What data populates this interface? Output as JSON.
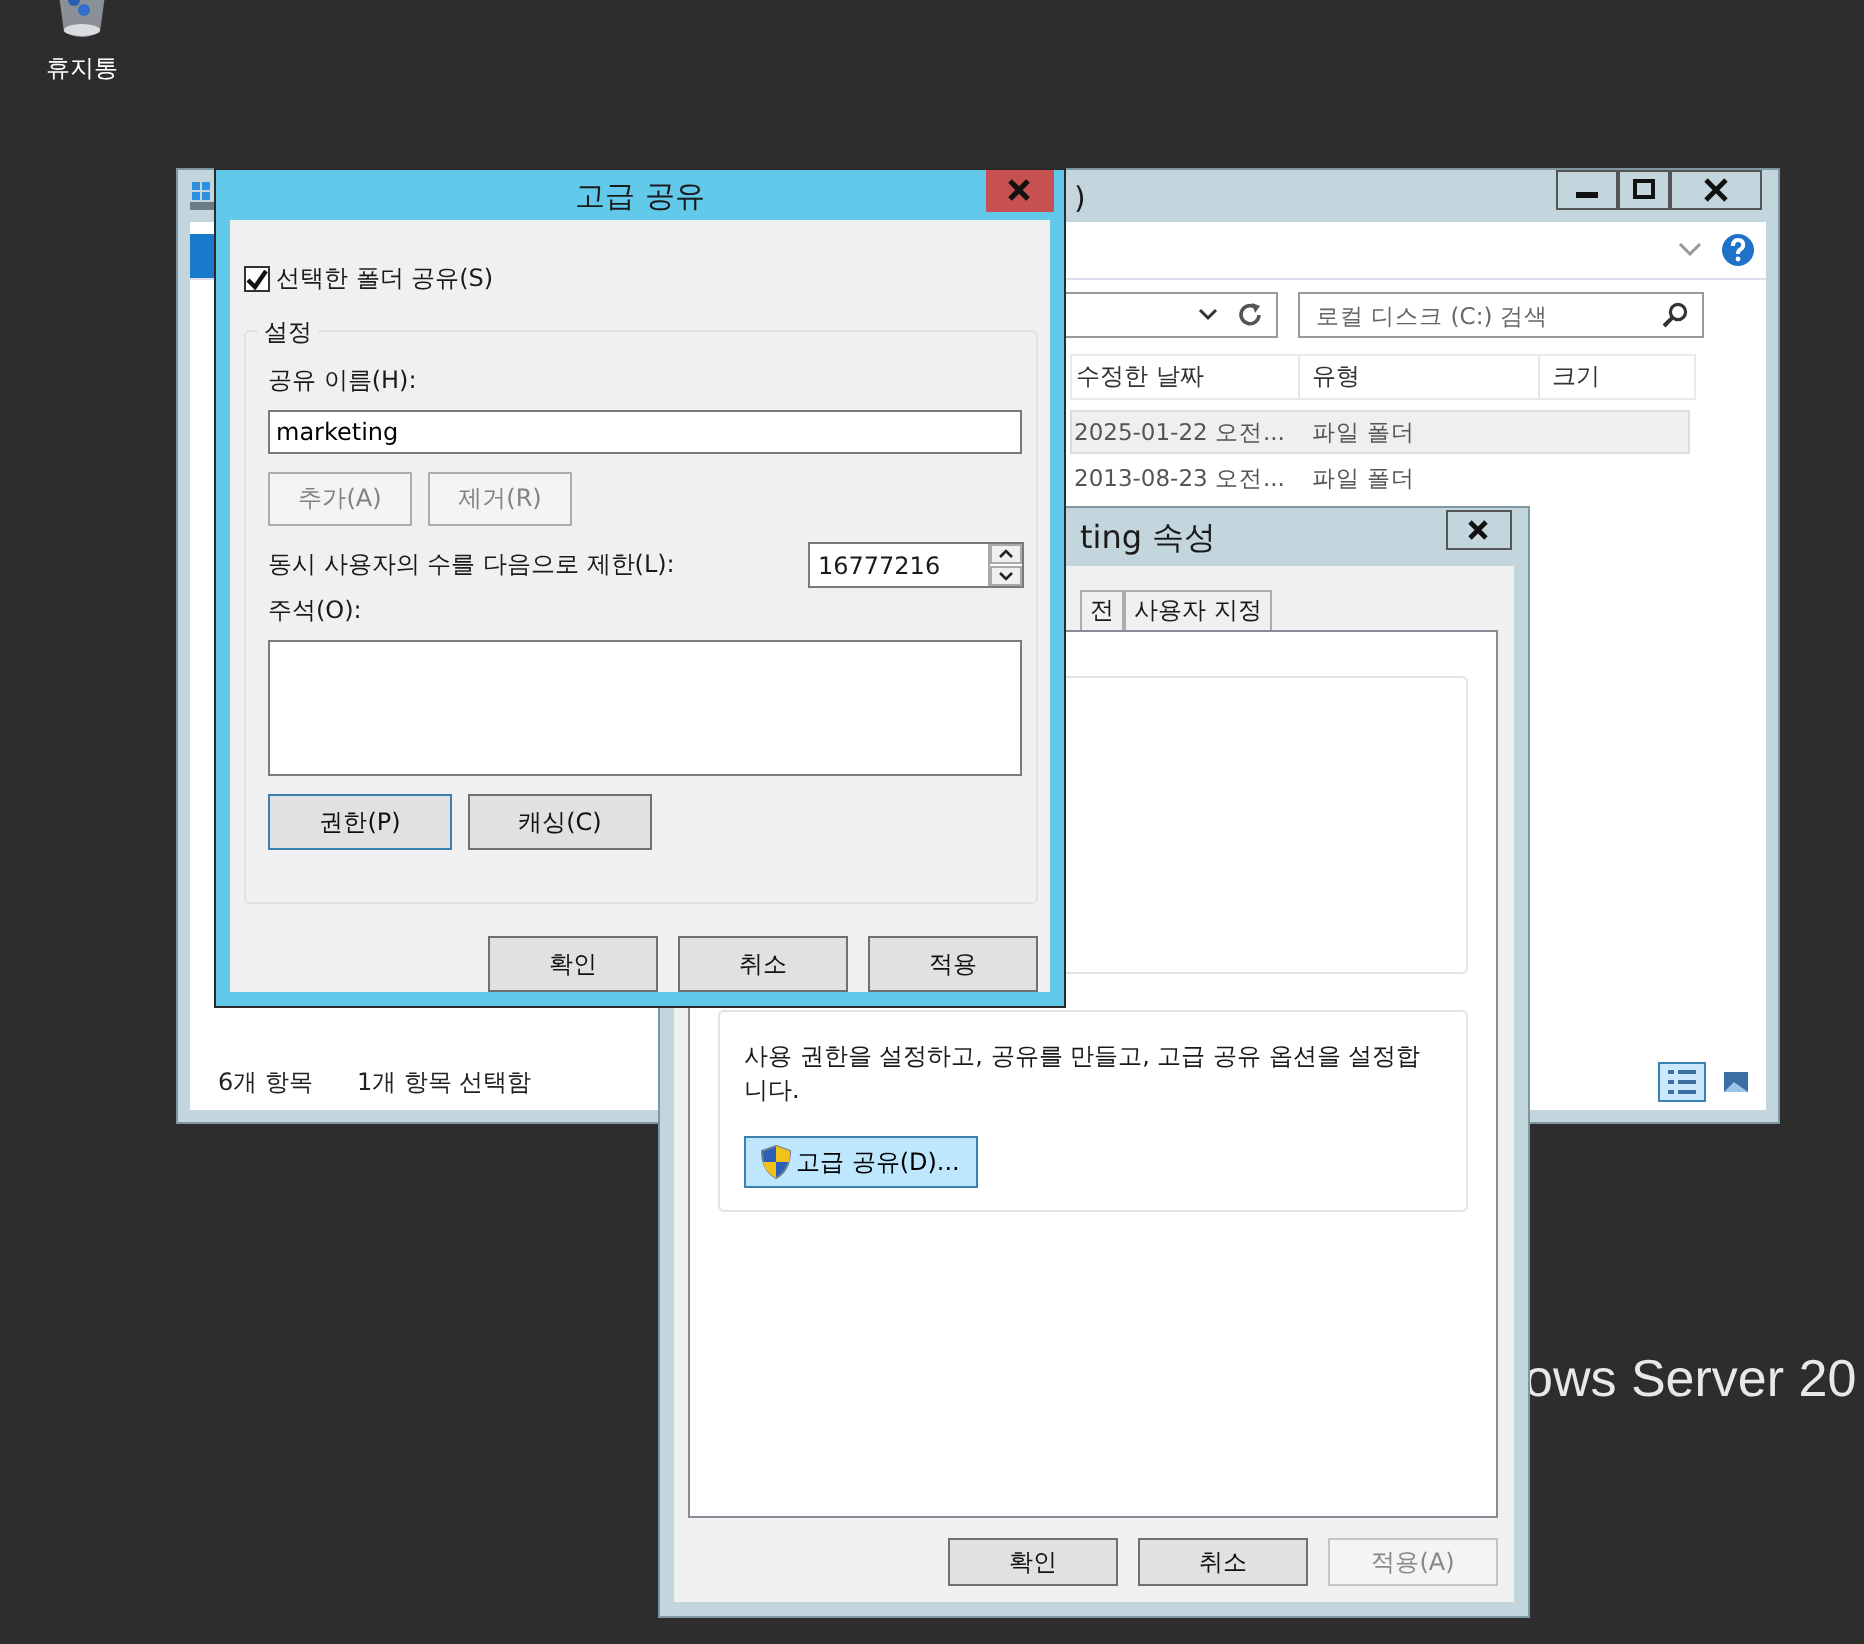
{
  "desktop": {
    "icons": [
      {
        "label": "휴지통"
      }
    ],
    "wallpaper_text": "ows Server 20"
  },
  "explorer": {
    "title": ")",
    "search": {
      "placeholder": "로컬 디스크 (C:) 검색"
    },
    "columns": [
      "수정한 날짜",
      "유형",
      "크기"
    ],
    "rows": [
      {
        "cells": [
          "2025-01-22 오전...",
          "파일 폴더"
        ],
        "selected": true
      },
      {
        "cells": [
          "2013-08-23 오전...",
          "파일 폴더"
        ],
        "selected": false
      }
    ],
    "status_bar": [
      "6개 항목",
      "1개 항목 선택함"
    ],
    "view_buttons": [
      {
        "kind": "details",
        "selected": true
      },
      {
        "kind": "thumbnails",
        "selected": false
      }
    ]
  },
  "properties": {
    "title": "ting 속성",
    "tabs": [
      {
        "label": "전",
        "selected": false
      },
      {
        "label": "사용자 지정",
        "selected": false
      }
    ],
    "sharing_description": "사용 권한을 설정하고, 공유를 만들고, 고급 공유 옵션을 설정합니다.",
    "advanced_button": "고급 공유(D)...",
    "buttons": [
      {
        "label": "확인",
        "disabled": false
      },
      {
        "label": "취소",
        "disabled": false
      },
      {
        "label": "적용(A)",
        "disabled": true
      }
    ]
  },
  "dialog": {
    "title": "고급 공유",
    "share_checkbox": {
      "label": "선택한 폴더 공유(S)",
      "checked": true
    },
    "group_title": "설정",
    "share_name_label": "공유 이름(H):",
    "share_name": "marketing",
    "name_buttons": [
      {
        "label": "추가(A)",
        "disabled": true
      },
      {
        "label": "제거(R)",
        "disabled": true
      }
    ],
    "limit_label": "동시 사용자의 수를 다음으로 제한(L):",
    "limit_value": "16777216",
    "comment_label": "주석(O):",
    "option_buttons": [
      {
        "label": "권한(P)",
        "focused": true
      },
      {
        "label": "캐싱(C)",
        "focused": false
      }
    ],
    "buttons": [
      {
        "label": "확인",
        "disabled": false
      },
      {
        "label": "취소",
        "disabled": false
      },
      {
        "label": "적용",
        "disabled": false
      }
    ]
  }
}
